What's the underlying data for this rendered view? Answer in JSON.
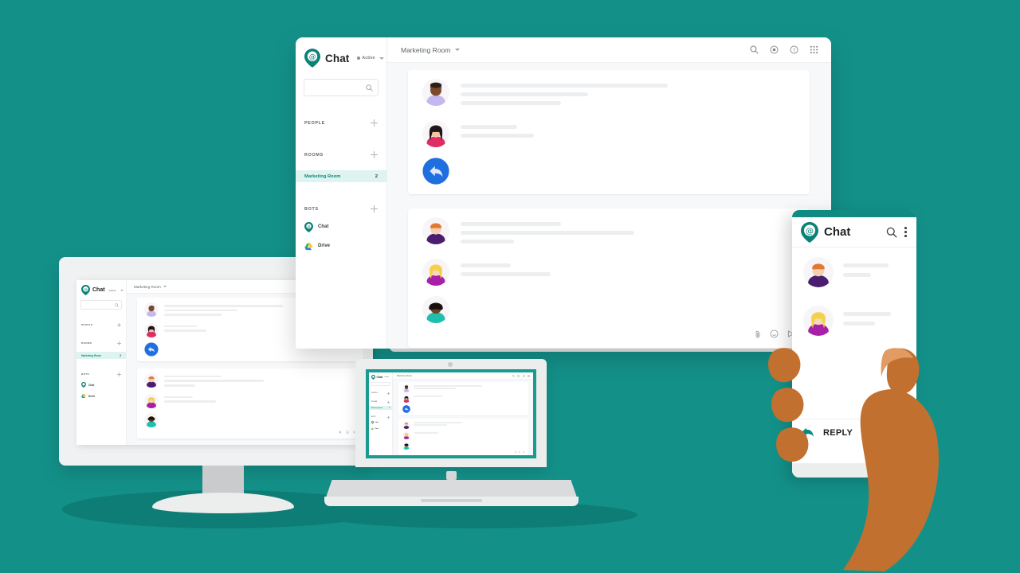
{
  "theme": {
    "background_teal": "#139189",
    "brand_teal": "#0d8a80",
    "room_highlight": "#dff3f0",
    "hand_skin": "#c2702f"
  },
  "app": {
    "name": "Chat",
    "status_label": "Active",
    "search_placeholder": ""
  },
  "sidebar": {
    "sections": [
      {
        "label": "PEOPLE",
        "add_icon": "plus-icon"
      },
      {
        "label": "ROOMS",
        "add_icon": "plus-icon"
      },
      {
        "label": "BOTS",
        "add_icon": "plus-icon"
      }
    ],
    "rooms": [
      {
        "name": "Marketing Room",
        "badge": "2",
        "selected": true
      }
    ],
    "bots": [
      {
        "name": "Chat",
        "icon": "chat-bot-icon"
      },
      {
        "name": "Drive",
        "icon": "drive-bot-icon"
      }
    ]
  },
  "main": {
    "room_title": "Marketing Room",
    "room_caret_icon": "chevron-down-icon",
    "header_icons": [
      "search-icon",
      "settings-icon",
      "help-icon",
      "apps-grid-icon"
    ],
    "composer_icons": [
      "attachment-icon",
      "emoji-icon",
      "send-icon"
    ],
    "threads": [
      {
        "messages": [
          {
            "avatar": "avatar-dark-lavender",
            "line_widths": [
              62,
              38,
              30
            ]
          },
          {
            "avatar": "avatar-darkhair-pink",
            "line_widths": [
              17,
              22
            ]
          },
          {
            "avatar": "avatar-blue-reply",
            "line_widths": []
          }
        ]
      },
      {
        "messages": [
          {
            "avatar": "avatar-ginger-purple",
            "line_widths": [
              30,
              52,
              16
            ]
          },
          {
            "avatar": "avatar-blonde-magenta",
            "line_widths": [
              15,
              27
            ]
          },
          {
            "avatar": "avatar-dark-teal",
            "line_widths": []
          }
        ]
      }
    ]
  },
  "phone": {
    "title": "Chat",
    "search_icon": "search-icon",
    "overflow_icon": "more-vertical-icon",
    "reply_label": "REPLY",
    "reply_icon": "reply-arrow-icon",
    "items": [
      {
        "avatar": "avatar-ginger-purple",
        "line_widths": [
          72,
          44
        ]
      },
      {
        "avatar": "avatar-blonde-magenta",
        "line_widths": [
          76,
          50
        ]
      }
    ]
  },
  "devices": {
    "monitor": {
      "label": "desktop-monitor"
    },
    "laptop": {
      "label": "laptop"
    },
    "phone": {
      "label": "smartphone-in-hand"
    }
  }
}
